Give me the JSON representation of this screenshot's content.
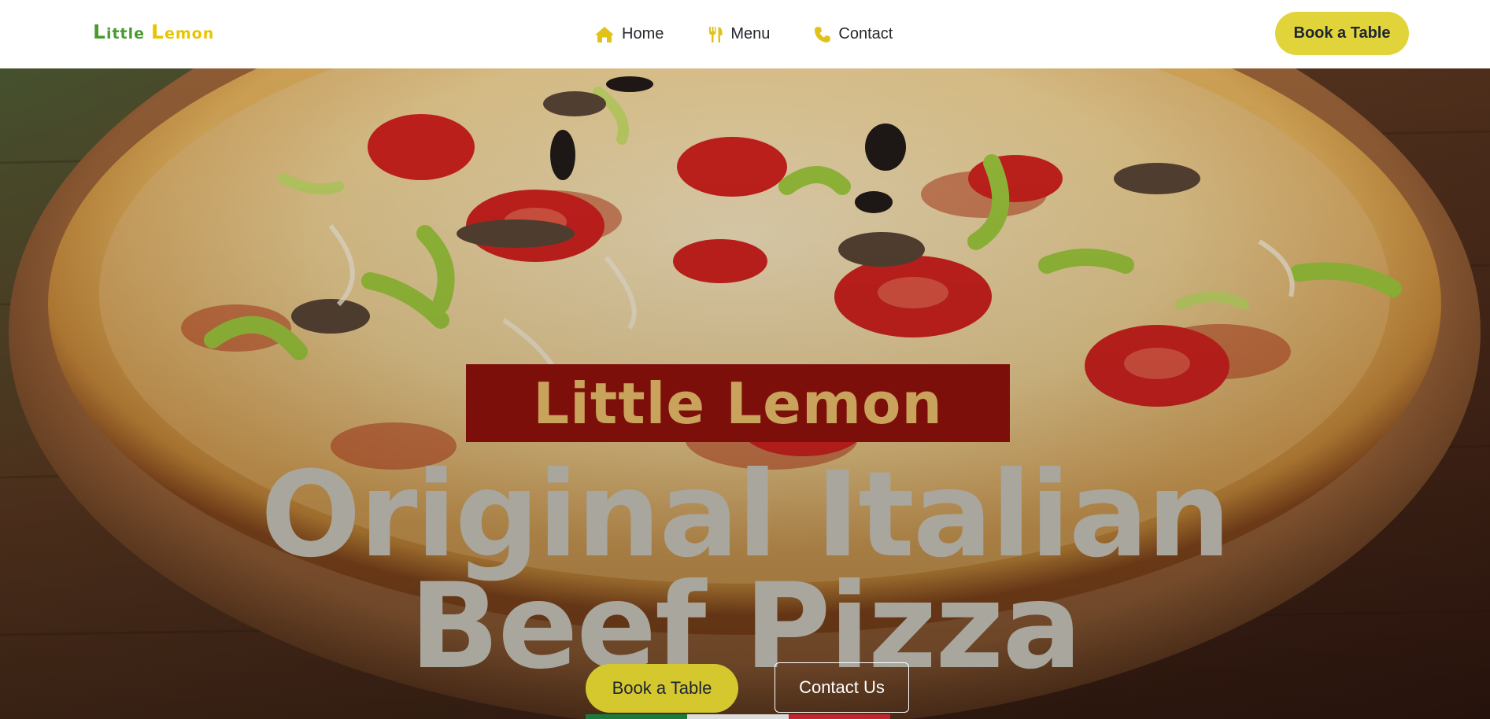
{
  "header": {
    "logo": {
      "word1_cap": "L",
      "word1_rest": "ittle",
      "word2_cap": "L",
      "word2_rest": "emon"
    },
    "nav": [
      {
        "label": "Home",
        "icon": "home-icon"
      },
      {
        "label": "Menu",
        "icon": "utensils-icon"
      },
      {
        "label": "Contact",
        "icon": "phone-icon"
      }
    ],
    "cta_label": "Book a Table"
  },
  "hero": {
    "brand": "Little Lemon",
    "headline_line1": "Original Italian",
    "headline_line2": "Beef Pizza",
    "primary_button": "Book a Table",
    "secondary_button": "Contact Us",
    "flag_colors": [
      "#1e7a3c",
      "#dcdcdc",
      "#c0262d"
    ]
  },
  "colors": {
    "accent_yellow": "#e1d43a",
    "brand_red": "#7d0f0b",
    "brand_gold": "#c9a25b",
    "logo_green": "#4a9b2f",
    "logo_yellow": "#e8c400"
  }
}
